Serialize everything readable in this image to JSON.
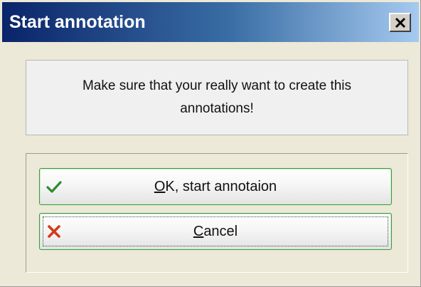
{
  "window": {
    "title": "Start annotation",
    "close_glyph": "×"
  },
  "message": {
    "text": "Make sure that your really want to create this annotations!"
  },
  "buttons": {
    "ok": {
      "label_mnemonic": "O",
      "label_rest": "K, start annotaion",
      "icon": "check-icon",
      "icon_color": "#2e8b2e"
    },
    "cancel": {
      "label_mnemonic": "C",
      "label_rest": "ancel",
      "icon": "x-icon",
      "icon_color": "#d43a1a"
    }
  },
  "colors": {
    "title_gradient_start": "#0a246a",
    "title_gradient_end": "#a6caf0",
    "button_border": "#3a9a3a"
  }
}
